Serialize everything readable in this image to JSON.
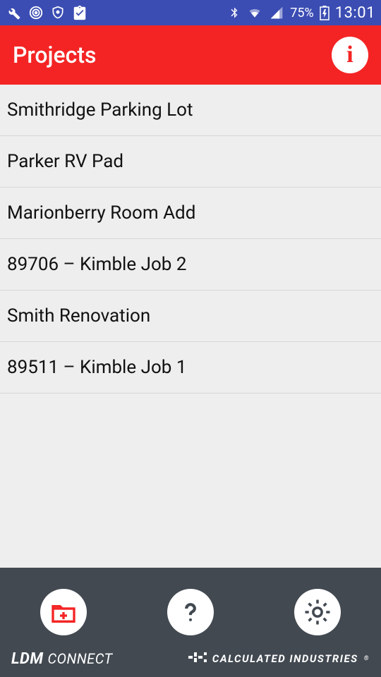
{
  "status": {
    "battery_pct": "75%",
    "time": "13:01"
  },
  "header": {
    "title": "Projects"
  },
  "projects": [
    {
      "name": "Smithridge Parking Lot"
    },
    {
      "name": "Parker RV Pad"
    },
    {
      "name": "Marionberry Room Add"
    },
    {
      "name": "89706 – Kimble Job 2"
    },
    {
      "name": "Smith Renovation"
    },
    {
      "name": "89511 – Kimble Job 1"
    }
  ],
  "brand": {
    "left_bold": "LDM",
    "left_light": "CONNECT",
    "right": "CALCULATED INDUSTRIES"
  }
}
